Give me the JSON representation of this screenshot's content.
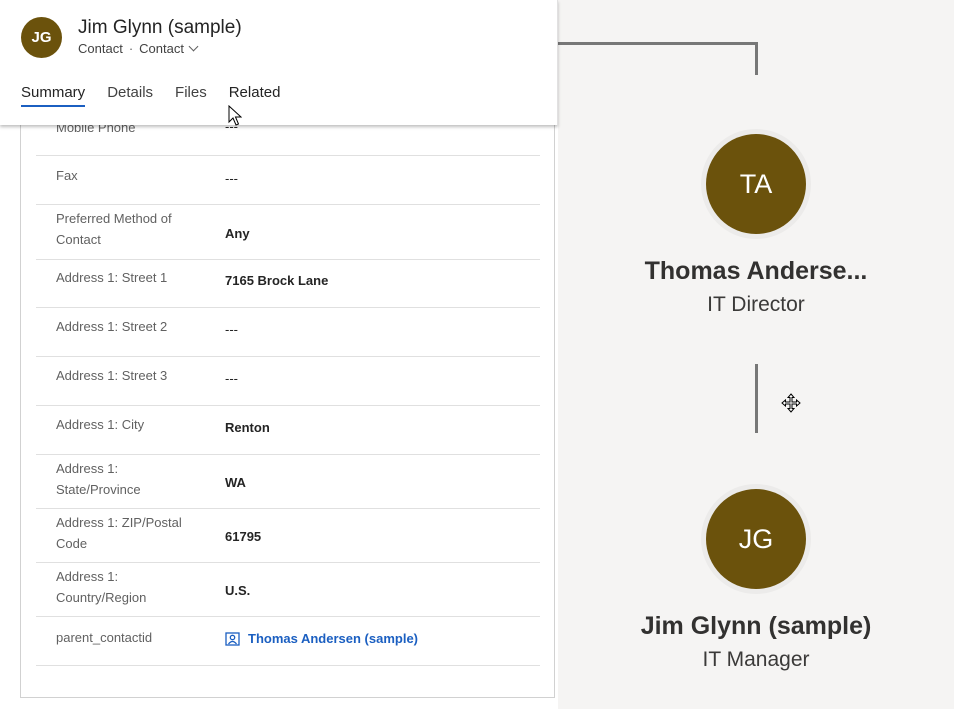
{
  "record": {
    "initials": "JG",
    "title": "Jim Glynn (sample)",
    "entity": "Contact",
    "form": "Contact"
  },
  "tabs": [
    {
      "label": "Summary",
      "active": true
    },
    {
      "label": "Details",
      "active": false
    },
    {
      "label": "Files",
      "active": false
    },
    {
      "label": "Related",
      "active": false
    }
  ],
  "fields": {
    "mobile": {
      "label": "Mobile Phone",
      "value": "---"
    },
    "fax": {
      "label": "Fax",
      "value": "---"
    },
    "preferred": {
      "label": "Preferred Method of Contact",
      "value": "Any"
    },
    "street1": {
      "label": "Address 1: Street 1",
      "value": "7165 Brock Lane"
    },
    "street2": {
      "label": "Address 1: Street 2",
      "value": "---"
    },
    "street3": {
      "label": "Address 1: Street 3",
      "value": "---"
    },
    "city": {
      "label": "Address 1: City",
      "value": "Renton"
    },
    "state": {
      "label": "Address 1: State/Province",
      "value": "WA"
    },
    "zip": {
      "label": "Address 1: ZIP/Postal Code",
      "value": "61795"
    },
    "country": {
      "label": "Address 1: Country/Region",
      "value": "U.S."
    },
    "parent": {
      "label": "parent_contactid",
      "value": "Thomas Andersen (sample)"
    }
  },
  "hierarchy": {
    "parent": {
      "initials": "TA",
      "name": "Thomas Anderse...",
      "role": "IT Director"
    },
    "child": {
      "initials": "JG",
      "name": "Jim Glynn (sample)",
      "role": "IT Manager"
    }
  },
  "colors": {
    "avatar": "#6b520c",
    "link": "#1b5fc1",
    "canvas": "#f5f4f3"
  }
}
